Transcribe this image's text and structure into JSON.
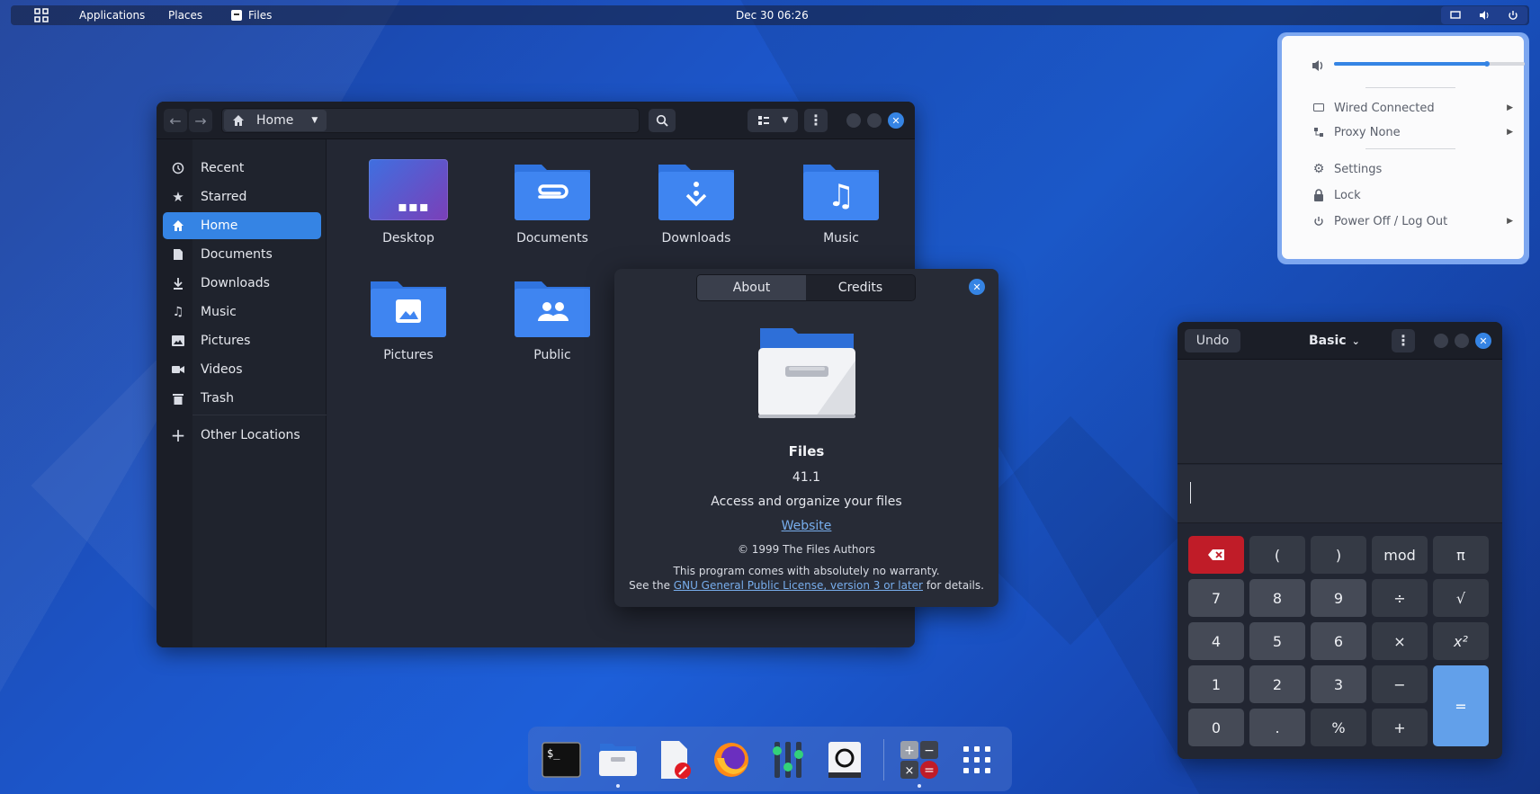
{
  "topbar": {
    "applications": "Applications",
    "places": "Places",
    "files_app": "Files",
    "clock": "Dec 30  06:26"
  },
  "files_window": {
    "location": "Home",
    "sidebar": [
      {
        "label": "Recent",
        "icon": "clock-icon"
      },
      {
        "label": "Starred",
        "icon": "star-icon"
      },
      {
        "label": "Home",
        "icon": "home-icon",
        "active": true
      },
      {
        "label": "Documents",
        "icon": "document-icon"
      },
      {
        "label": "Downloads",
        "icon": "download-icon"
      },
      {
        "label": "Music",
        "icon": "music-icon"
      },
      {
        "label": "Pictures",
        "icon": "picture-icon"
      },
      {
        "label": "Videos",
        "icon": "video-icon"
      },
      {
        "label": "Trash",
        "icon": "trash-icon"
      },
      {
        "label": "Other Locations",
        "icon": "plus-icon"
      }
    ],
    "folders": [
      "Desktop",
      "Documents",
      "Downloads",
      "Music",
      "Pictures",
      "Public"
    ]
  },
  "about": {
    "tabs": [
      "About",
      "Credits"
    ],
    "app_name": "Files",
    "version": "41.1",
    "description": "Access and organize your files",
    "website": "Website",
    "copyright": "© 1999 The Files Authors",
    "warranty": "This program comes with absolutely no warranty.",
    "license_prefix": "See the ",
    "license_link": "GNU General Public License, version 3 or later",
    "license_suffix": " for details."
  },
  "system_menu": {
    "volume_level": 0.8,
    "items": [
      {
        "label": "Wired Connected",
        "icon": "network-icon",
        "submenu": true
      },
      {
        "label": "Proxy None",
        "icon": "proxy-icon",
        "submenu": true
      },
      {
        "label": "Settings",
        "icon": "gear-icon",
        "submenu": false
      },
      {
        "label": "Lock",
        "icon": "lock-icon",
        "submenu": false
      },
      {
        "label": "Power Off / Log Out",
        "icon": "power-icon",
        "submenu": true
      }
    ]
  },
  "calculator": {
    "undo": "Undo",
    "mode": "Basic",
    "keys": [
      [
        "⌫",
        "(",
        ")",
        "mod",
        "π"
      ],
      [
        "7",
        "8",
        "9",
        "÷",
        "√"
      ],
      [
        "4",
        "5",
        "6",
        "×",
        "x²"
      ],
      [
        "1",
        "2",
        "3",
        "−",
        "="
      ],
      [
        "0",
        ".",
        "%",
        "+",
        ""
      ]
    ]
  },
  "colors": {
    "accent": "#3584e4",
    "backspace": "#c01c28"
  }
}
